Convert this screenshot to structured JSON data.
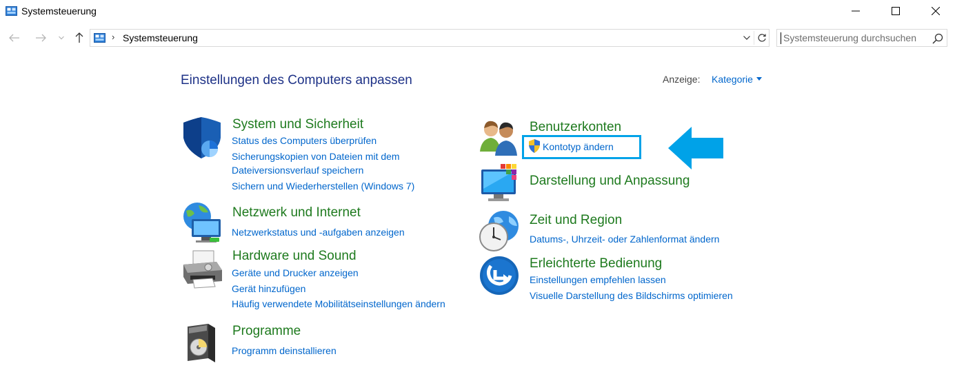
{
  "window": {
    "title": "Systemsteuerung",
    "minimize_glyph": "—",
    "maximize_glyph": "☐",
    "close_glyph": "✕"
  },
  "nav": {
    "back_glyph": "←",
    "forward_glyph": "→",
    "recent_glyph": "⌄",
    "up_glyph": "↑",
    "separator": "›",
    "address": "Systemsteuerung",
    "search_placeholder": "Systemsteuerung durchsuchen"
  },
  "header": {
    "title": "Einstellungen des Computers anpassen",
    "view_label": "Anzeige:",
    "view_value": "Kategorie"
  },
  "categories": {
    "system": {
      "title": "System und Sicherheit",
      "icon": "shield-icon",
      "links": [
        "Status des Computers überprüfen",
        "Sicherungskopien von Dateien mit dem",
        "Dateiversionsverlauf speichern",
        "Sichern und Wiederherstellen (Windows 7)"
      ]
    },
    "network": {
      "title": "Netzwerk und Internet",
      "icon": "network-globe-icon",
      "links": [
        "Netzwerkstatus und -aufgaben anzeigen"
      ]
    },
    "hardware": {
      "title": "Hardware und Sound",
      "icon": "printer-icon",
      "links": [
        "Geräte und Drucker anzeigen",
        "Gerät hinzufügen",
        "Häufig verwendete Mobilitätseinstellungen ändern"
      ]
    },
    "programs": {
      "title": "Programme",
      "icon": "programs-icon",
      "links": [
        "Programm deinstallieren"
      ]
    },
    "accounts": {
      "title": "Benutzerkonten",
      "icon": "users-icon",
      "links": [
        "Kontotyp ändern"
      ]
    },
    "appearance": {
      "title": "Darstellung und Anpassung",
      "icon": "monitor-colors-icon",
      "links": []
    },
    "clock": {
      "title": "Zeit und Region",
      "icon": "clock-globe-icon",
      "links": [
        "Datums-, Uhrzeit- oder Zahlenformat ändern"
      ]
    },
    "access": {
      "title": "Erleichterte Bedienung",
      "icon": "ease-of-access-icon",
      "links": [
        "Einstellungen empfehlen lassen",
        "Visuelle Darstellung des Bildschirms optimieren"
      ]
    }
  },
  "colors": {
    "category_title": "#1e7a1e",
    "link": "#0066cc",
    "page_title": "#1e3287",
    "highlight": "#00a2e8"
  }
}
